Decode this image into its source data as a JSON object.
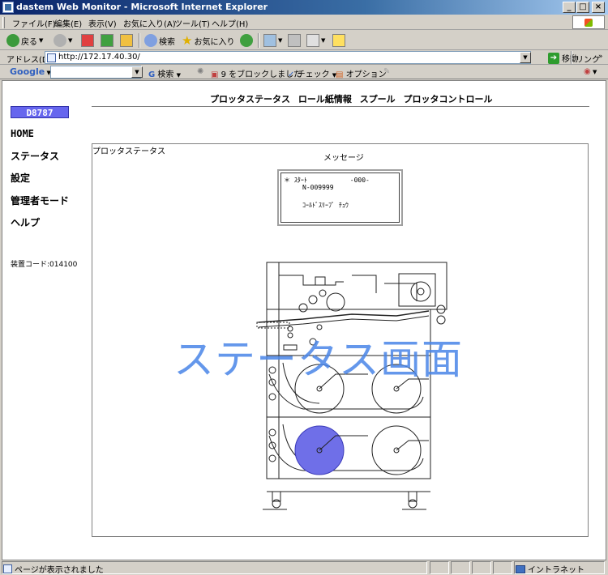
{
  "window": {
    "title": "dastem Web Monitor - Microsoft Internet Explorer"
  },
  "menubar": {
    "items": [
      "ファイル(F)",
      "編集(E)",
      "表示(V)",
      "お気に入り(A)",
      "ツール(T)",
      "ヘルプ(H)"
    ]
  },
  "toolbar": {
    "back": "戻る",
    "search": "検索",
    "favorites": "お気に入り"
  },
  "addressbar": {
    "label": "アドレス(D)",
    "url": "http://172.17.40.30/",
    "go": "移動",
    "links": "リンク"
  },
  "googlebar": {
    "logo": "Google",
    "search": "検索",
    "blocked": "9 をブロックしました",
    "check": "チェック",
    "options": "オプション"
  },
  "page": {
    "logo": "D8787",
    "topnav": [
      "プロッタステータス",
      "ロール紙情報",
      "スプール",
      "プロッタコントロール"
    ],
    "sidenav": [
      "HOME",
      "ステータス",
      "設定",
      "管理者モード",
      "ヘルプ"
    ],
    "device_code": "装置コード:014100",
    "panel_title": "プロッタステータス",
    "message_title": "メッセージ",
    "message_lines": [
      "＊ ｽﾀｰﾄ           -000-",
      "N-009999",
      "ｺｰﾙﾄﾞｽﾘｰﾌﾟ ﾁｭｳ"
    ],
    "watermark": "ステータス画面"
  },
  "statusbar": {
    "text": "ページが表示されました",
    "zone": "イントラネット"
  },
  "colors": {
    "highlight_roll": "#6f6fe8",
    "watermark": "#4a86e8",
    "logo_bg": "#6666ee"
  }
}
